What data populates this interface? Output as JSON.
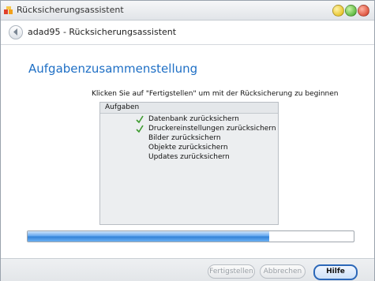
{
  "window": {
    "title": "Rücksicherungsassistent"
  },
  "nav": {
    "title": "adad95 - Rücksicherungsassistent"
  },
  "main": {
    "heading": "Aufgabenzusammenstellung",
    "instruction": "Klicken Sie auf \"Fertigstellen\" um mit der Rücksicherung zu beginnen",
    "tasks_header": "Aufgaben",
    "tasks": [
      {
        "label": "Datenbank zurücksichern",
        "done": true
      },
      {
        "label": "Druckereinstellungen zurücksichern",
        "done": true
      },
      {
        "label": "Bilder zurücksichern",
        "done": false
      },
      {
        "label": "Objekte zurücksichern",
        "done": false
      },
      {
        "label": "Updates zurücksichern",
        "done": false
      }
    ]
  },
  "progress": {
    "fraction": 0.74
  },
  "buttons": {
    "finish": "Fertigstellen",
    "cancel": "Abbrechen",
    "help": "Hilfe"
  },
  "colors": {
    "accent": "#1e6fc5",
    "check": "#3c9a2e"
  },
  "icons": {
    "app": "app-icon",
    "back": "back-arrow-icon",
    "check": "checkmark-icon"
  }
}
